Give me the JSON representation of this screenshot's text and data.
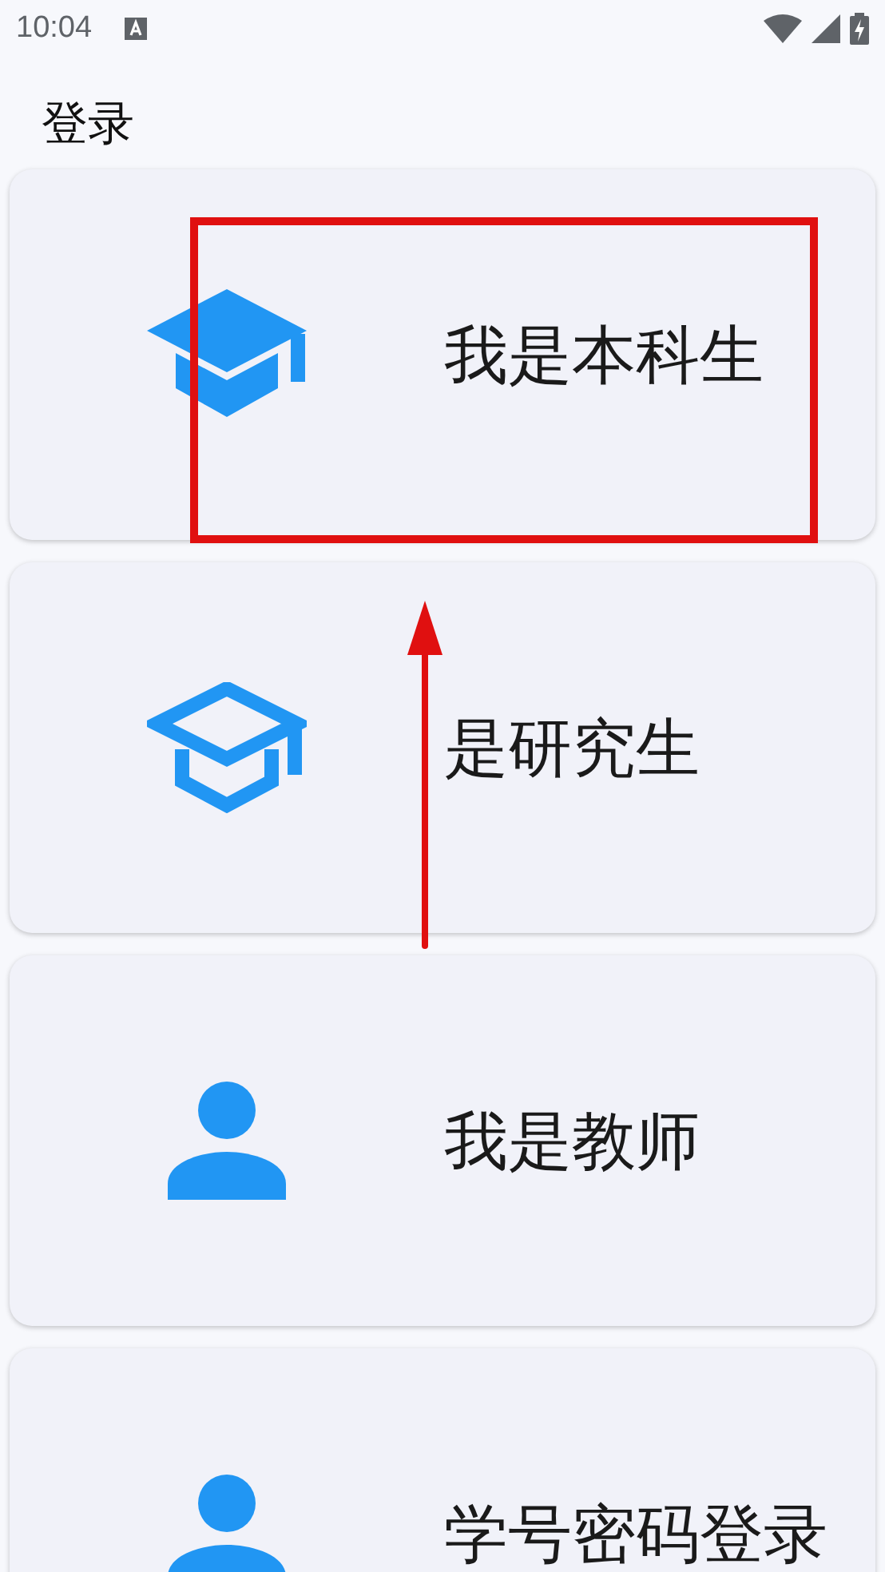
{
  "status_bar": {
    "time": "10:04"
  },
  "title": "登录",
  "options": [
    {
      "label": "我是本科生",
      "kind": "undergraduate"
    },
    {
      "label": "是研究生",
      "kind": "graduate"
    },
    {
      "label": "我是教师",
      "kind": "teacher"
    },
    {
      "label": "学号密码登录",
      "kind": "password"
    }
  ]
}
